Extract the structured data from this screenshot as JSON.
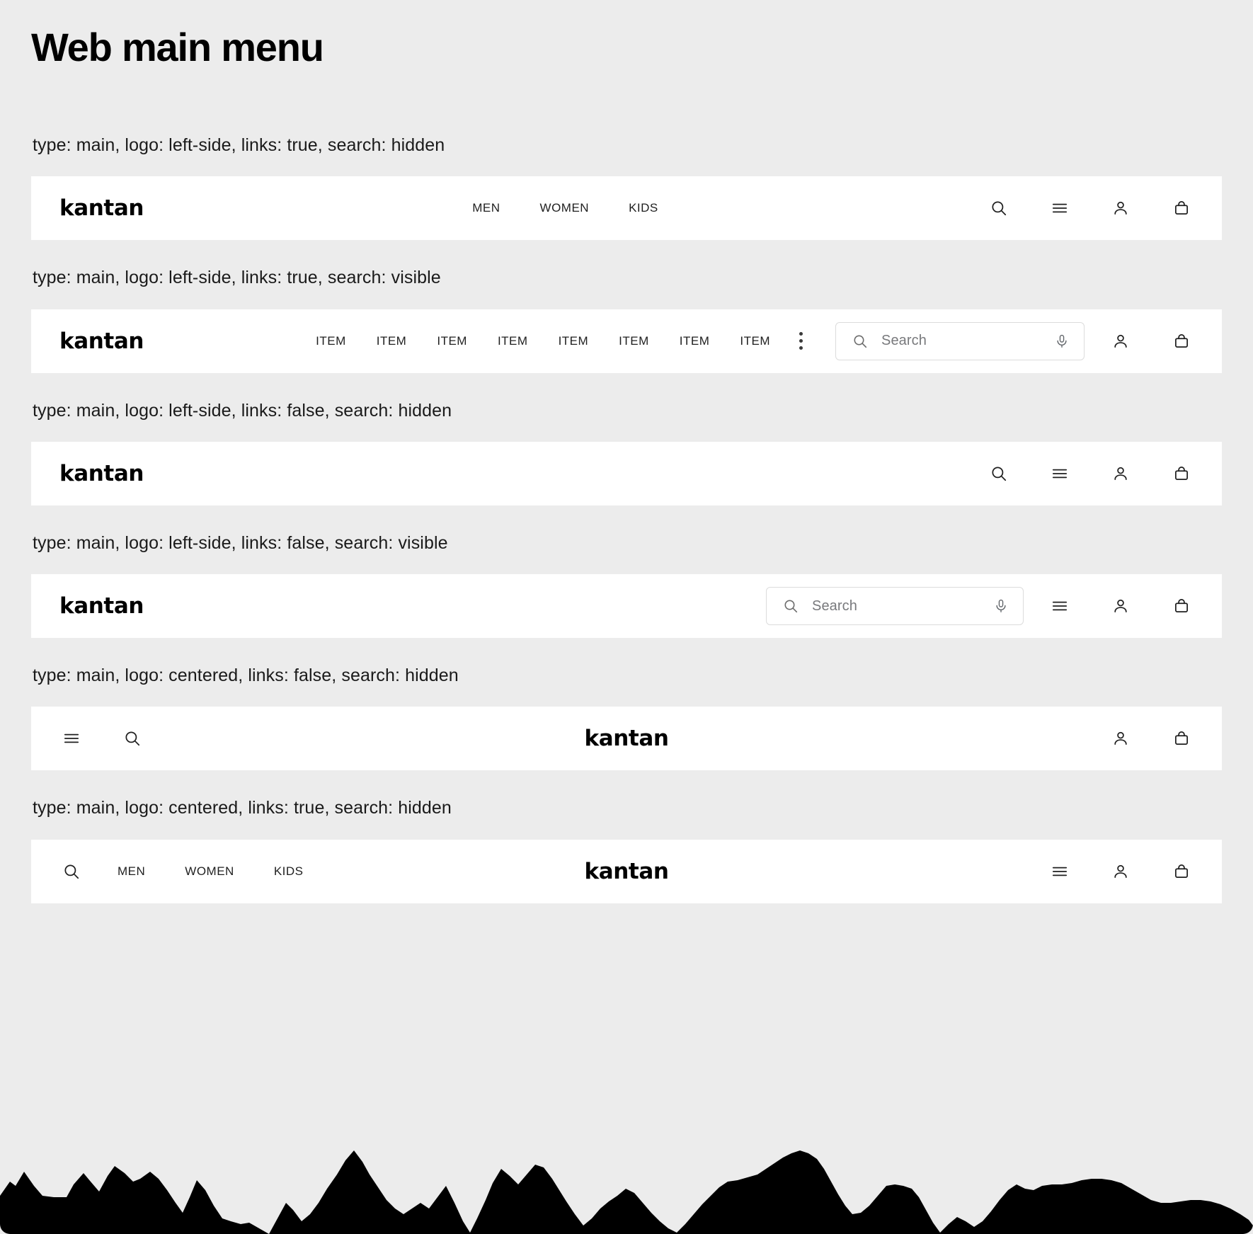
{
  "page": {
    "title": "Web main menu",
    "background_color": "#ececec",
    "navbar_color": "#ffffff"
  },
  "brand": {
    "logo_text": "kantan"
  },
  "search": {
    "placeholder": "Search",
    "search_icon": "search-icon",
    "mic_icon": "microphone-icon"
  },
  "variants": [
    {
      "caption": "type: main, logo: left-side, links: true, search: hidden",
      "logo": "left-side",
      "links": [
        "MEN",
        "WOMEN",
        "KIDS"
      ],
      "icons": [
        "search-icon",
        "hamburger-icon",
        "account-icon",
        "bag-icon"
      ]
    },
    {
      "caption": "type: main, logo: left-side, links: true, search: visible",
      "logo": "left-side",
      "links": [
        "ITEM",
        "ITEM",
        "ITEM",
        "ITEM",
        "ITEM",
        "ITEM",
        "ITEM",
        "ITEM"
      ],
      "overflow_icon": "kebab-menu-icon",
      "icons": [
        "account-icon",
        "bag-icon"
      ]
    },
    {
      "caption": "type: main, logo: left-side, links: false, search: hidden",
      "logo": "left-side",
      "links": [],
      "icons": [
        "search-icon",
        "hamburger-icon",
        "account-icon",
        "bag-icon"
      ]
    },
    {
      "caption": "type: main, logo: left-side, links: false, search: visible",
      "logo": "left-side",
      "links": [],
      "icons": [
        "hamburger-icon",
        "account-icon",
        "bag-icon"
      ]
    },
    {
      "caption": "type: main, logo: centered, links: false, search: hidden",
      "logo": "centered",
      "left_icons": [
        "hamburger-icon",
        "search-icon"
      ],
      "links": [],
      "icons": [
        "account-icon",
        "bag-icon"
      ]
    },
    {
      "caption": "type: main, logo: centered, links: true, search: hidden",
      "logo": "centered",
      "left_icons": [
        "search-icon"
      ],
      "links": [
        "MEN",
        "WOMEN",
        "KIDS"
      ],
      "icons": [
        "hamburger-icon",
        "account-icon",
        "bag-icon"
      ]
    }
  ]
}
